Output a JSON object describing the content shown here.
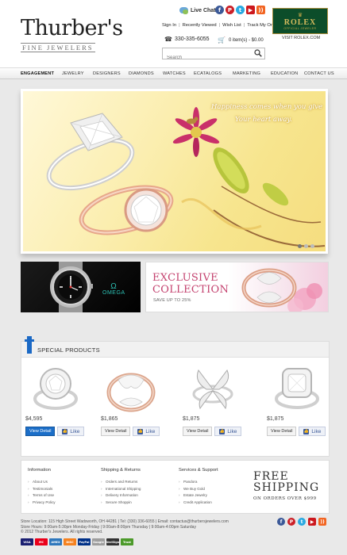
{
  "brand": {
    "name": "Thurber's",
    "tagline": "FINE JEWELERS"
  },
  "header": {
    "live_chat": "Live Chat",
    "links": [
      "Sign In",
      "Recently Viewed",
      "Wish List",
      "Track My Order"
    ],
    "phone": "330-335-6055",
    "cart": "0 item(s) - $0.00",
    "search_placeholder": "Search"
  },
  "rolex": {
    "name": "ROLEX",
    "sub": "OFFICIAL JEWELER",
    "visit": "VISIT ROLEX.COM"
  },
  "nav": {
    "items": [
      "Engagement",
      "Jewelry",
      "Designers",
      "Diamonds",
      "Watches",
      "eCatalogs",
      "Marketing",
      "Education",
      "Contact Us"
    ],
    "active": "Engagement"
  },
  "hero": {
    "line1": "Happiness comes when you give",
    "line2": "Your heart away."
  },
  "promos": {
    "omega": "OMEGA",
    "exclusive_line1": "EXCLUSIVE",
    "exclusive_line2": "COLLECTION",
    "exclusive_sub": "SAVE UP TO 25%"
  },
  "special": {
    "title": "SPECIAL PRODUCTS",
    "view_label": "View Detail",
    "like_label": "Like",
    "products": [
      {
        "price": "$4,595"
      },
      {
        "price": "$1,865"
      },
      {
        "price": "$1,875"
      },
      {
        "price": "$1,875"
      }
    ]
  },
  "footer": {
    "info_title": "Information",
    "info_items": [
      "About Us",
      "Testimonials",
      "Terms of Use",
      "Privacy Policy"
    ],
    "ship_title": "Shipping & Returns",
    "ship_items": [
      "Orders and Returns",
      "International Shipping",
      "Delivery Information",
      "Secure Shoppin"
    ],
    "services_title": "Services & Support",
    "services_items": [
      "Pandora",
      "We Buy Gold",
      "Estate Jewelry",
      "Credit Application"
    ],
    "free_line1": "FREE",
    "free_line2": "SHIPPING",
    "free_line3": "ON ORDERS OVER $999"
  },
  "store": {
    "location": "Store Location: 115 High Street  Wadsworth,  OH  44281  |  Tel: (330) 336-6055  |  Email: contactus@thurbersjewelers.com",
    "hours": "Store Hours: 9:00am-5:30pm Monday-Friday  |  9:00am-8:00pm Thursday  |  9:00am-4:00pm Saturday",
    "copyright": "© 2012 Thurber's Jewelers. All rights reserved."
  },
  "cards": [
    "VISA",
    "MC",
    "AMEX",
    "DISC",
    "PayPal",
    "Google",
    "VeriSign",
    "Trust"
  ],
  "colors": {
    "accent_blue": "#1b6ec8",
    "exclusive_pink": "#c4426f",
    "rolex_green": "#0c4d2a",
    "omega_teal": "#2cc0b4"
  }
}
